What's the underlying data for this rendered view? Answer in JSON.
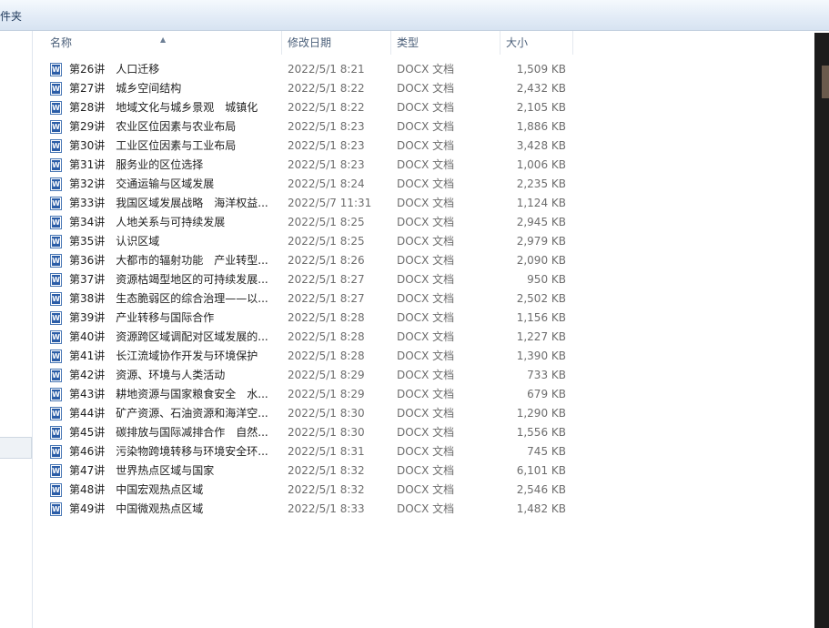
{
  "toolbar": {
    "label": "件夹"
  },
  "columns": {
    "name": "名称",
    "date": "修改日期",
    "type": "类型",
    "size": "大小",
    "sort_icon": "sort-ascending-icon"
  },
  "file_icon": "word-document-icon",
  "files": [
    {
      "name": "第26讲　人口迁移",
      "date": "2022/5/1 8:21",
      "type": "DOCX 文档",
      "size": "1,509 KB"
    },
    {
      "name": "第27讲　城乡空间结构",
      "date": "2022/5/1 8:22",
      "type": "DOCX 文档",
      "size": "2,432 KB"
    },
    {
      "name": "第28讲　地域文化与城乡景观　城镇化",
      "date": "2022/5/1 8:22",
      "type": "DOCX 文档",
      "size": "2,105 KB"
    },
    {
      "name": "第29讲　农业区位因素与农业布局",
      "date": "2022/5/1 8:23",
      "type": "DOCX 文档",
      "size": "1,886 KB"
    },
    {
      "name": "第30讲　工业区位因素与工业布局",
      "date": "2022/5/1 8:23",
      "type": "DOCX 文档",
      "size": "3,428 KB"
    },
    {
      "name": "第31讲　服务业的区位选择",
      "date": "2022/5/1 8:23",
      "type": "DOCX 文档",
      "size": "1,006 KB"
    },
    {
      "name": "第32讲　交通运输与区域发展",
      "date": "2022/5/1 8:24",
      "type": "DOCX 文档",
      "size": "2,235 KB"
    },
    {
      "name": "第33讲　我国区域发展战略　海洋权益...",
      "date": "2022/5/7 11:31",
      "type": "DOCX 文档",
      "size": "1,124 KB"
    },
    {
      "name": "第34讲　人地关系与可持续发展",
      "date": "2022/5/1 8:25",
      "type": "DOCX 文档",
      "size": "2,945 KB"
    },
    {
      "name": "第35讲　认识区域",
      "date": "2022/5/1 8:25",
      "type": "DOCX 文档",
      "size": "2,979 KB"
    },
    {
      "name": "第36讲　大都市的辐射功能　产业转型...",
      "date": "2022/5/1 8:26",
      "type": "DOCX 文档",
      "size": "2,090 KB"
    },
    {
      "name": "第37讲　资源枯竭型地区的可持续发展...",
      "date": "2022/5/1 8:27",
      "type": "DOCX 文档",
      "size": "950 KB"
    },
    {
      "name": "第38讲　生态脆弱区的综合治理——以...",
      "date": "2022/5/1 8:27",
      "type": "DOCX 文档",
      "size": "2,502 KB"
    },
    {
      "name": "第39讲　产业转移与国际合作",
      "date": "2022/5/1 8:28",
      "type": "DOCX 文档",
      "size": "1,156 KB"
    },
    {
      "name": "第40讲　资源跨区域调配对区域发展的...",
      "date": "2022/5/1 8:28",
      "type": "DOCX 文档",
      "size": "1,227 KB"
    },
    {
      "name": "第41讲　长江流域协作开发与环境保护",
      "date": "2022/5/1 8:28",
      "type": "DOCX 文档",
      "size": "1,390 KB"
    },
    {
      "name": "第42讲　资源、环境与人类活动",
      "date": "2022/5/1 8:29",
      "type": "DOCX 文档",
      "size": "733 KB"
    },
    {
      "name": "第43讲　耕地资源与国家粮食安全　水...",
      "date": "2022/5/1 8:29",
      "type": "DOCX 文档",
      "size": "679 KB"
    },
    {
      "name": "第44讲　矿产资源、石油资源和海洋空...",
      "date": "2022/5/1 8:30",
      "type": "DOCX 文档",
      "size": "1,290 KB"
    },
    {
      "name": "第45讲　碳排放与国际减排合作　自然...",
      "date": "2022/5/1 8:30",
      "type": "DOCX 文档",
      "size": "1,556 KB"
    },
    {
      "name": "第46讲　污染物跨境转移与环境安全环...",
      "date": "2022/5/1 8:31",
      "type": "DOCX 文档",
      "size": "745 KB"
    },
    {
      "name": "第47讲　世界热点区域与国家",
      "date": "2022/5/1 8:32",
      "type": "DOCX 文档",
      "size": "6,101 KB"
    },
    {
      "name": "第48讲　中国宏观热点区域",
      "date": "2022/5/1 8:32",
      "type": "DOCX 文档",
      "size": "2,546 KB"
    },
    {
      "name": "第49讲　中国微观热点区域",
      "date": "2022/5/1 8:33",
      "type": "DOCX 文档",
      "size": "1,482 KB"
    }
  ]
}
